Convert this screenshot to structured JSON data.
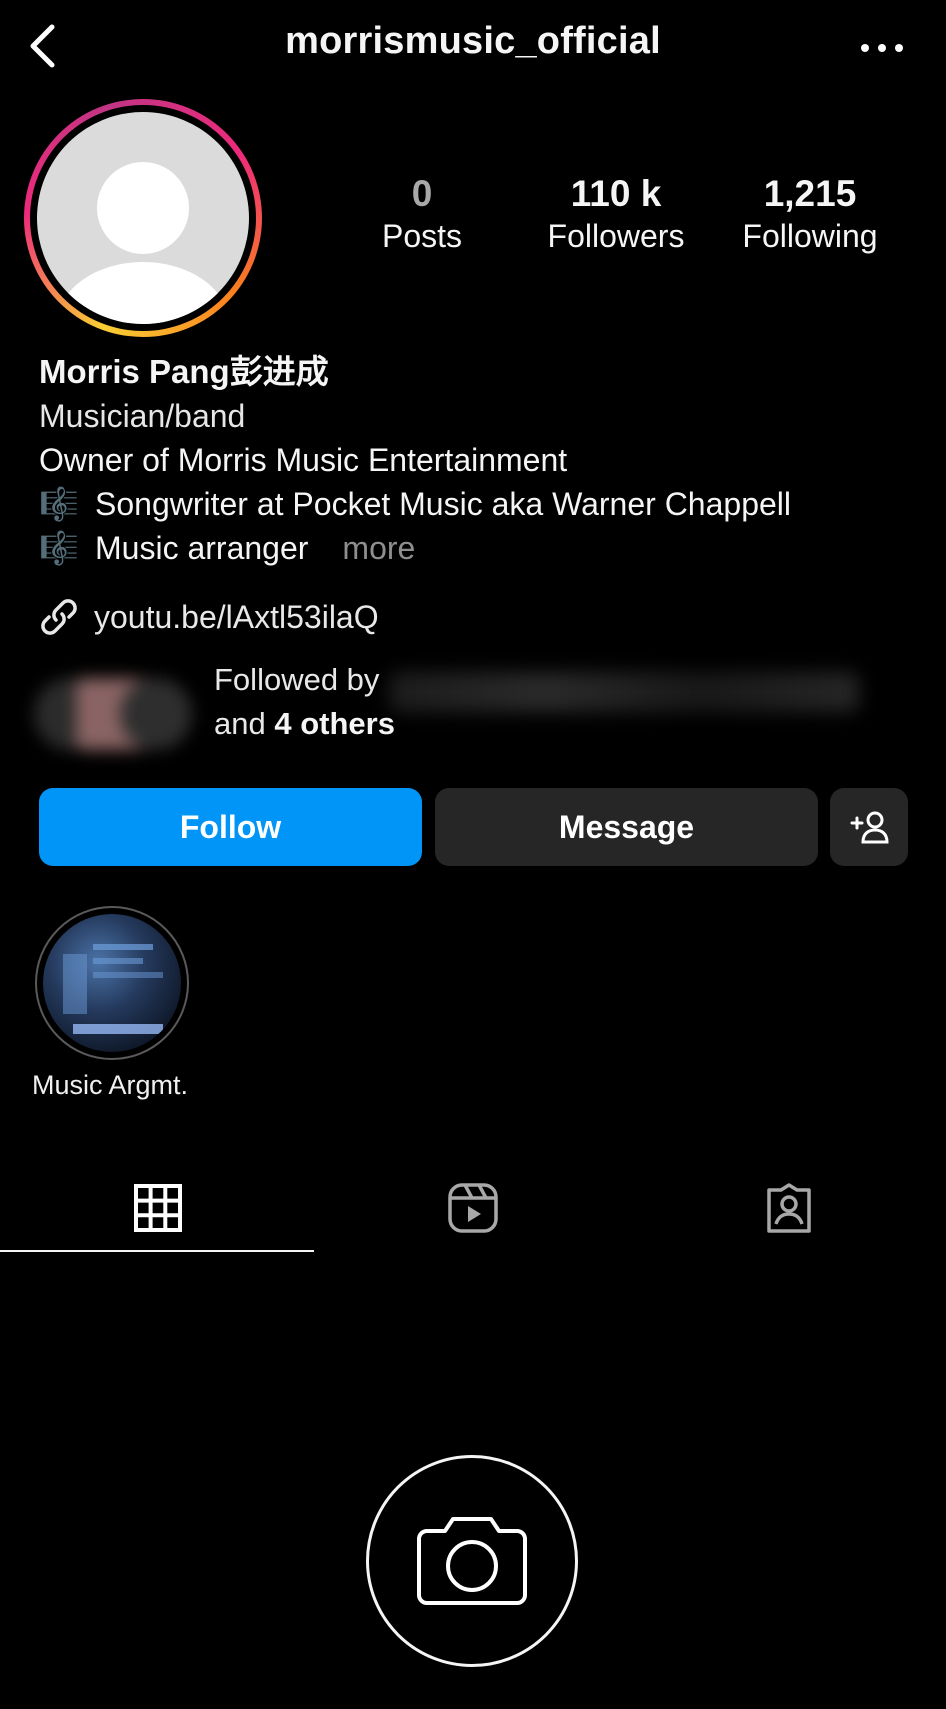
{
  "header": {
    "username": "morrismusic_official"
  },
  "stats": {
    "posts": {
      "value": "0",
      "label": "Posts"
    },
    "followers": {
      "value": "110 k",
      "label": "Followers"
    },
    "following": {
      "value": "1,215",
      "label": "Following"
    }
  },
  "bio": {
    "name": "Morris Pang彭进成",
    "category": "Musician/band",
    "line1": "Owner of Morris Music Entertainment",
    "line2_icon": "🎼",
    "line2": "Songwriter at Pocket Music aka Warner Chappell",
    "line3_icon": "🎼",
    "line3": "Music arranger",
    "more": "more",
    "link": "youtu.be/lAxtl53ilaQ"
  },
  "followed_by": {
    "prefix": "Followed by",
    "and": "and",
    "others": "4 others"
  },
  "actions": {
    "follow": "Follow",
    "message": "Message"
  },
  "highlights": [
    {
      "label": "Music Argmt."
    }
  ],
  "colors": {
    "follow_blue": "#0095f6",
    "button_gray": "#262626",
    "background": "#000000"
  },
  "icons": {
    "back": "chevron-left-icon",
    "more": "more-horizontal-icon",
    "link": "link-icon",
    "add_user": "add-user-icon",
    "grid": "grid-icon",
    "reels": "reels-icon",
    "tagged": "tagged-icon",
    "camera": "camera-icon"
  }
}
